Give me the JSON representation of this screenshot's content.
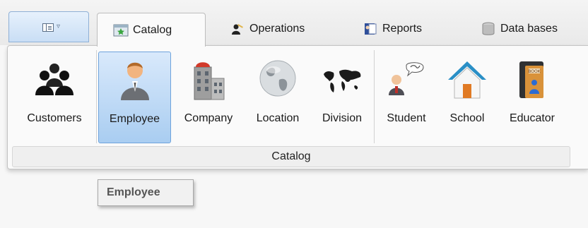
{
  "tabs": [
    {
      "label": "Catalog",
      "icon": "catalog-icon",
      "active": true
    },
    {
      "label": "Operations",
      "icon": "operations-icon",
      "active": false
    },
    {
      "label": "Reports",
      "icon": "reports-icon",
      "active": false
    },
    {
      "label": "Data bases",
      "icon": "database-icon",
      "active": false
    }
  ],
  "app_menu": {
    "icon": "sidebar-toggle-icon",
    "caret": "▿"
  },
  "ribbon": {
    "group_label": "Catalog",
    "buttons": [
      {
        "label": "Customers",
        "icon": "customers-icon"
      },
      {
        "label": "Employee",
        "icon": "employee-icon",
        "selected": true
      },
      {
        "label": "Company",
        "icon": "company-building-icon"
      },
      {
        "label": "Location",
        "icon": "globe-icon"
      },
      {
        "label": "Division",
        "icon": "world-map-icon"
      },
      {
        "label": "Student",
        "icon": "student-icon"
      },
      {
        "label": "School",
        "icon": "school-house-icon"
      },
      {
        "label": "Educator",
        "icon": "educator-book-icon"
      }
    ]
  },
  "tooltip": {
    "text": "Employee"
  },
  "colors": {
    "selected_fill": "#a9cdf1",
    "selected_border": "#6ea3dc",
    "house_roof": "#2a8fc6"
  }
}
